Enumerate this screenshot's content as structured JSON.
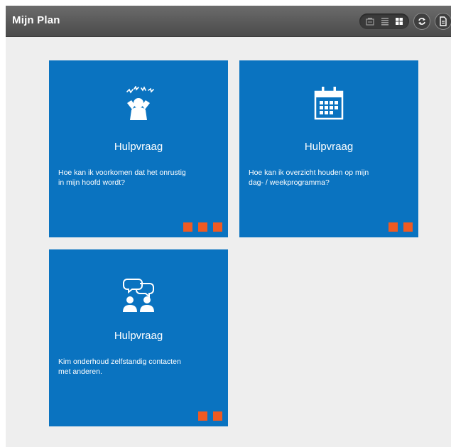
{
  "header": {
    "title": "Mijn Plan",
    "view_icons": [
      "tile-view-icon",
      "list-view-icon",
      "grid-view-icon"
    ],
    "action_icons": [
      "refresh-icon",
      "document-icon"
    ]
  },
  "colors": {
    "card_bg": "#0a73c0",
    "accent": "#f05a22",
    "header_bg": "#555555",
    "content_bg": "#eeeeee"
  },
  "cards": [
    {
      "icon": "stressed-person-icon",
      "title": "Hulpvraag",
      "text_line1": "Hoe kan ik voorkomen dat het onrustig",
      "text_line2": "in mijn hoofd wordt?",
      "indicator_count": 3
    },
    {
      "icon": "calendar-icon",
      "title": "Hulpvraag",
      "text_line1": "Hoe kan ik overzicht houden op mijn",
      "text_line2": "dag- / weekprogramma?",
      "indicator_count": 2
    },
    {
      "icon": "people-conversation-icon",
      "title": "Hulpvraag",
      "text_line1": "Kim onderhoud zelfstandig contacten",
      "text_line2": "met anderen.",
      "indicator_count": 2
    }
  ]
}
